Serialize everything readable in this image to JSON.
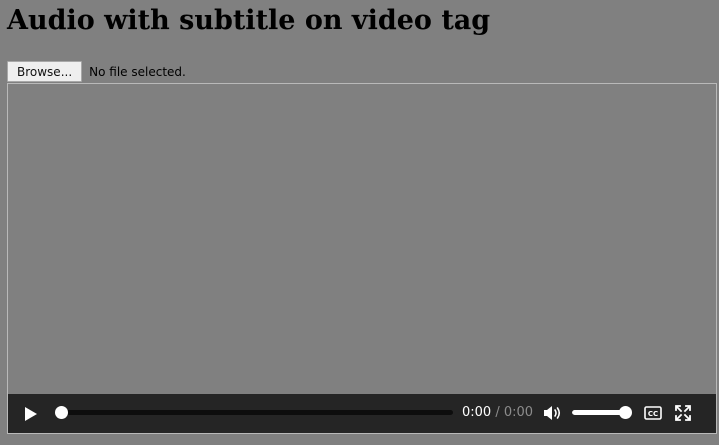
{
  "page": {
    "title": "Audio with subtitle on video tag"
  },
  "file_input": {
    "button_label": "Browse...",
    "status": "No file selected."
  },
  "video": {
    "background_color": "#808080",
    "controls": {
      "bar_color": "#252525",
      "play_icon": "play-icon",
      "time_current": "0:00",
      "time_separator": "/",
      "time_duration": "0:00",
      "seek_progress": 0,
      "mute_icon": "speaker-icon",
      "volume_level": 1,
      "captions_icon": "closed-captions-icon",
      "captions_label": "CC",
      "fullscreen_icon": "fullscreen-icon"
    }
  }
}
